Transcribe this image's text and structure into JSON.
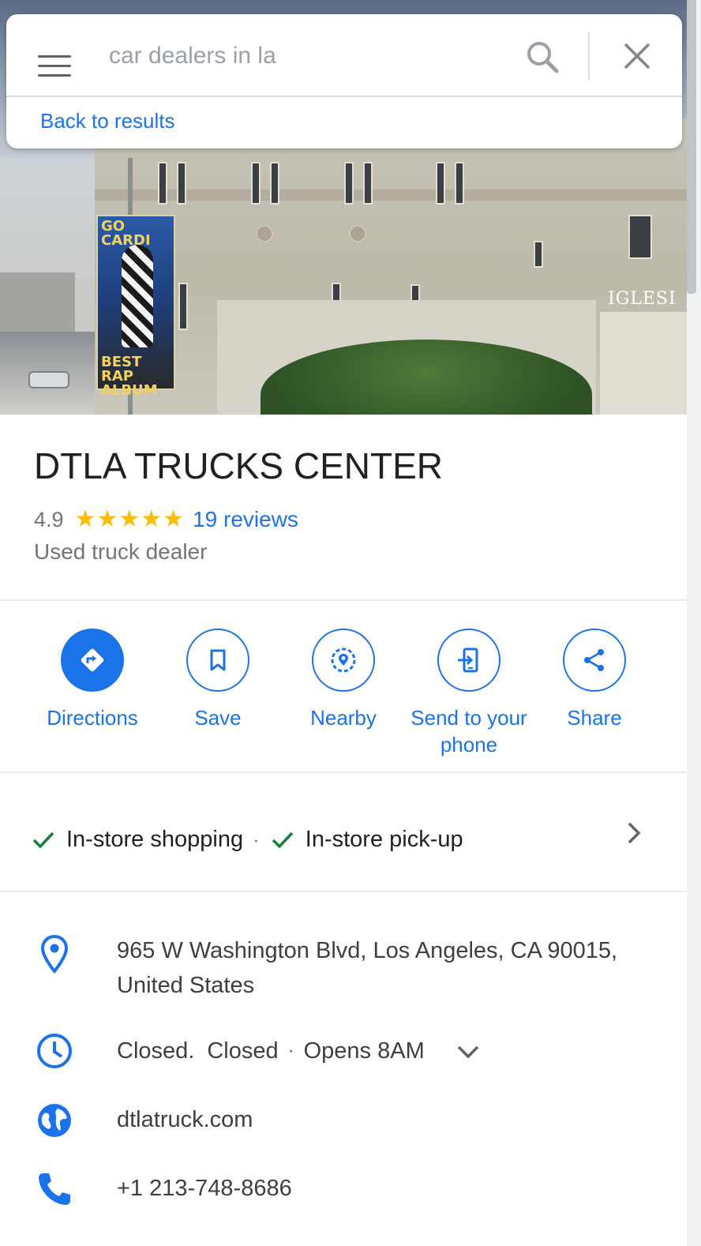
{
  "search": {
    "placeholder": "car dealers in la",
    "back_label": "Back to results"
  },
  "hero": {
    "banner_top": "GO CARDI",
    "banner_bottom": "BEST RAP ALBUM",
    "building_sign": "IGLESI"
  },
  "place": {
    "name": "DTLA TRUCKS CENTER",
    "rating": "4.9",
    "stars": [
      "★",
      "★",
      "★",
      "★",
      "★"
    ],
    "reviews": "19 reviews",
    "category": "Used truck dealer"
  },
  "actions": [
    {
      "label": "Directions",
      "icon": "directions-icon"
    },
    {
      "label": "Save",
      "icon": "bookmark-icon"
    },
    {
      "label": "Nearby",
      "icon": "nearby-icon"
    },
    {
      "label": "Send to your phone",
      "icon": "send-to-phone-icon"
    },
    {
      "label": "Share",
      "icon": "share-icon"
    }
  ],
  "amenities": {
    "item1": "In-store shopping",
    "separator": "·",
    "item2": "In-store pick-up"
  },
  "info": {
    "address_line1": "965 W Washington Blvd, Los Angeles, CA 90015,",
    "address_line2": "United States",
    "hours_status": "Closed.",
    "hours_closed": "Closed",
    "hours_sep": "·",
    "hours_opens": "Opens 8AM",
    "website": "dtlatruck.com",
    "phone": "+1 213-748-8686"
  },
  "colors": {
    "accent": "#1a73e8",
    "star": "#fbbc04",
    "closed": "#d93025",
    "check": "#188038"
  }
}
